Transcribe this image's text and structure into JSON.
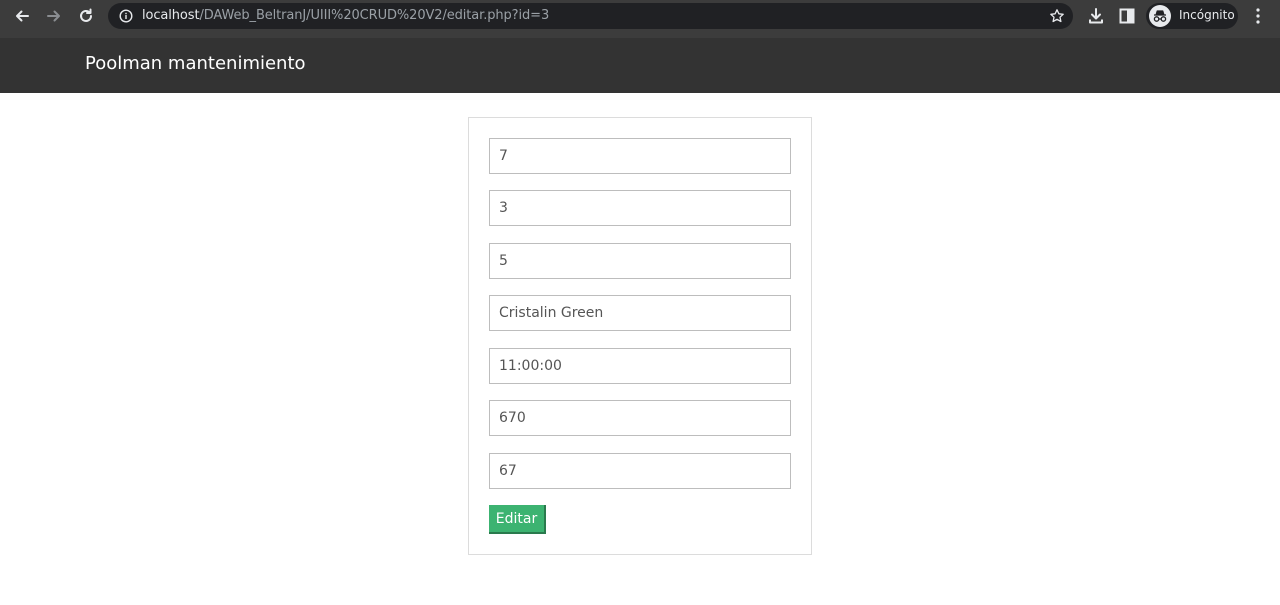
{
  "browser": {
    "url_host": "localhost",
    "url_path": "/DAWeb_BeltranJ/UIII%20CRUD%20V2/editar.php?id=3",
    "profile_label": "Incógnito",
    "icons": [
      "back-icon",
      "forward-icon",
      "reload-icon",
      "info-icon",
      "star-icon",
      "download-icon",
      "side-panel-icon",
      "incognito-icon",
      "kebab-menu-icon"
    ]
  },
  "navbar": {
    "brand": "Poolman mantenimiento",
    "background": "#333333"
  },
  "form": {
    "fields": [
      {
        "value": "7"
      },
      {
        "value": "3"
      },
      {
        "value": "5"
      },
      {
        "value": "Cristalin Green"
      },
      {
        "value": "11:00:00"
      },
      {
        "value": "670"
      },
      {
        "value": "67"
      }
    ],
    "submit_label": "Editar",
    "submit_color": "#3cb371"
  }
}
